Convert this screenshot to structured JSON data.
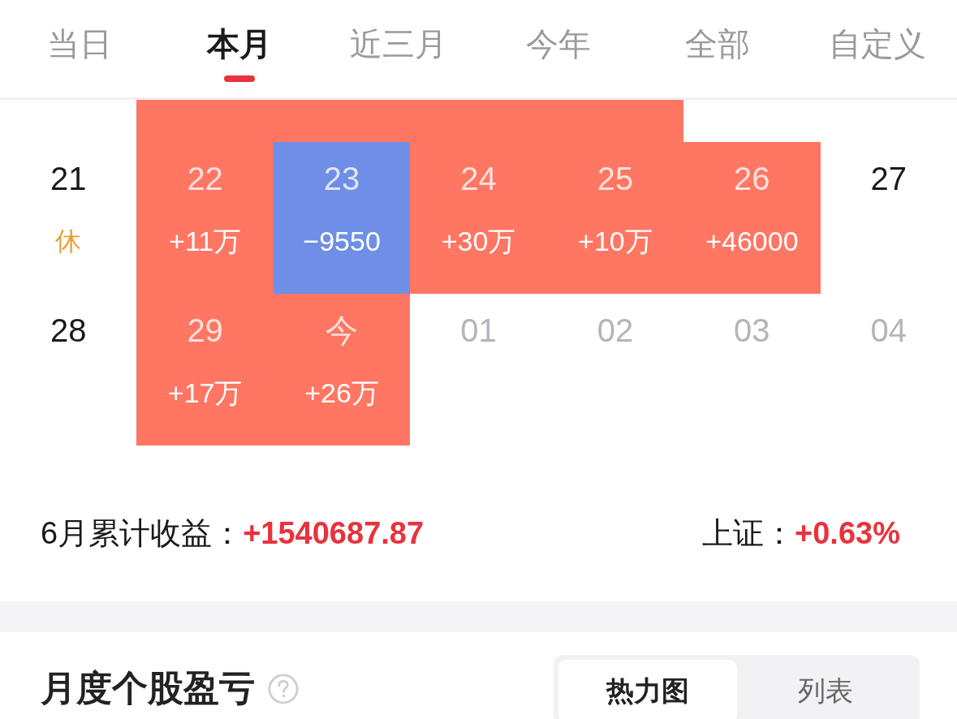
{
  "tabs": [
    {
      "label": "当日",
      "selected": false
    },
    {
      "label": "本月",
      "selected": true
    },
    {
      "label": "近三月",
      "selected": false
    },
    {
      "label": "今年",
      "selected": false
    },
    {
      "label": "全部",
      "selected": false
    },
    {
      "label": "自定义",
      "selected": false
    }
  ],
  "calendar": {
    "partial_week": {
      "cells": [
        {
          "color": "#ffffff"
        },
        {
          "color": "#ff7663"
        },
        {
          "color": "#ff7663"
        },
        {
          "color": "#ff7663"
        },
        {
          "color": "#ff7663"
        },
        {
          "color": "#ffffff"
        },
        {
          "color": "#ffffff"
        }
      ]
    },
    "weeks": [
      {
        "days": [
          {
            "date": "21",
            "note": "休",
            "color": "#ffffff",
            "muted": false
          },
          {
            "date": "22",
            "amount": "+11万",
            "color": "#ff7663",
            "muted": false
          },
          {
            "date": "23",
            "amount": "−9550",
            "color": "#6f8fe6",
            "muted": false
          },
          {
            "date": "24",
            "amount": "+30万",
            "color": "#ff7663",
            "muted": false
          },
          {
            "date": "25",
            "amount": "+10万",
            "color": "#ff7663",
            "muted": false
          },
          {
            "date": "26",
            "amount": "+46000",
            "color": "#ff7663",
            "muted": false
          },
          {
            "date": "27",
            "color": "#ffffff",
            "muted": false
          }
        ]
      },
      {
        "days": [
          {
            "date": "28",
            "color": "#ffffff",
            "muted": false
          },
          {
            "date": "29",
            "amount": "+17万",
            "color": "#ff7663",
            "muted": false
          },
          {
            "date": "今",
            "amount": "+26万",
            "color": "#ff7663",
            "muted": false
          },
          {
            "date": "01",
            "color": "#ffffff",
            "muted": true
          },
          {
            "date": "02",
            "color": "#ffffff",
            "muted": true
          },
          {
            "date": "03",
            "color": "#ffffff",
            "muted": true
          },
          {
            "date": "04",
            "color": "#ffffff",
            "muted": true
          }
        ]
      }
    ]
  },
  "summary": {
    "label": "6月累计收益：",
    "value": "+1540687.87",
    "index_label": "上证：",
    "index_value": "+0.63%"
  },
  "section": {
    "title": "月度个股盈亏",
    "view_options": [
      {
        "label": "热力图",
        "selected": true
      },
      {
        "label": "列表",
        "selected": false
      }
    ]
  }
}
